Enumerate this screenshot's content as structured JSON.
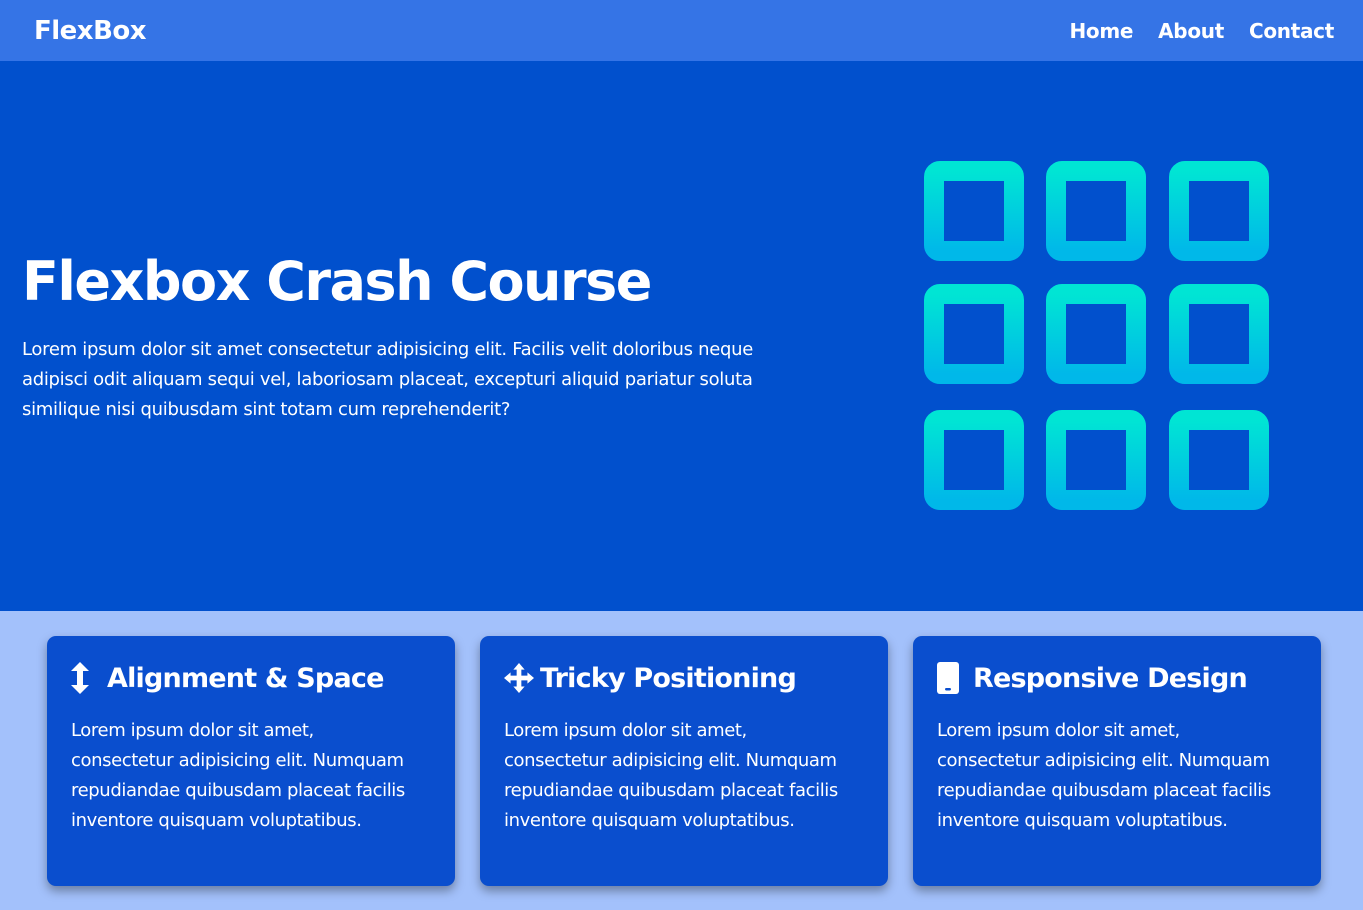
{
  "navbar": {
    "logo": "FlexBox",
    "links": [
      {
        "label": "Home"
      },
      {
        "label": "About"
      },
      {
        "label": "Contact"
      }
    ]
  },
  "showcase": {
    "title": "Flexbox Crash Course",
    "description": "Lorem ipsum dolor sit amet consectetur adipisicing elit. Facilis velit doloribus neque adipisci odit aliquam sequi vel, laboriosam placeat, excepturi aliquid pariatur soluta similique nisi quibusdam sint totam cum reprehenderit?",
    "graphic_icon": "grid-3x3-icon",
    "graphic_colors": [
      "#00e5d4",
      "#00b8e9"
    ]
  },
  "features": [
    {
      "icon": "arrows-vertical-icon",
      "title": "Alignment & Space",
      "body": "Lorem ipsum dolor sit amet, consectetur adipisicing elit. Numquam repudiandae quibusdam placeat facilis inventore quisquam voluptatibus."
    },
    {
      "icon": "arrows-move-icon",
      "title": "Tricky Positioning",
      "body": "Lorem ipsum dolor sit amet, consectetur adipisicing elit. Numquam repudiandae quibusdam placeat facilis inventore quisquam voluptatibus."
    },
    {
      "icon": "mobile-phone-icon",
      "title": "Responsive Design",
      "body": "Lorem ipsum dolor sit amet, consectetur adipisicing elit. Numquam repudiandae quibusdam placeat facilis inventore quisquam voluptatibus."
    }
  ],
  "colors": {
    "navbar_bg": "#3574e6",
    "showcase_bg": "#0150cd",
    "features_bg": "#a3c1fb",
    "card_bg": "#0a4ece"
  }
}
